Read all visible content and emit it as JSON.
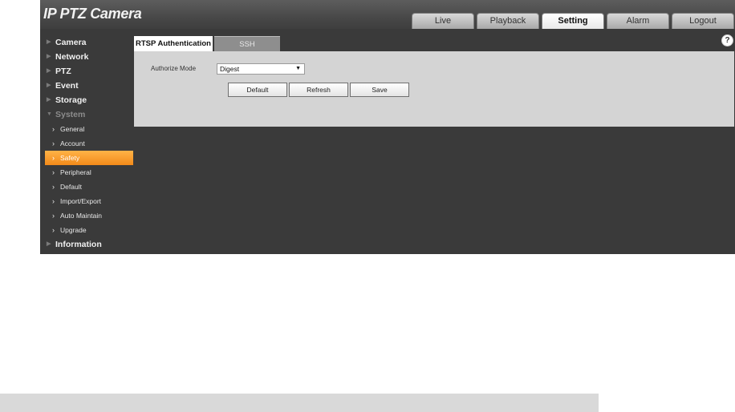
{
  "app": {
    "title": "IP PTZ Camera"
  },
  "nav": {
    "tabs": [
      {
        "label": "Live"
      },
      {
        "label": "Playback"
      },
      {
        "label": "Setting",
        "active": true
      },
      {
        "label": "Alarm"
      },
      {
        "label": "Logout"
      }
    ]
  },
  "sidebar": {
    "items": [
      {
        "label": "Camera"
      },
      {
        "label": "Network"
      },
      {
        "label": "PTZ"
      },
      {
        "label": "Event"
      },
      {
        "label": "Storage"
      },
      {
        "label": "System",
        "expanded": true
      }
    ],
    "system_sub": [
      {
        "label": "General"
      },
      {
        "label": "Account"
      },
      {
        "label": "Safety",
        "active": true
      },
      {
        "label": "Peripheral"
      },
      {
        "label": "Default"
      },
      {
        "label": "Import/Export"
      },
      {
        "label": "Auto Maintain"
      },
      {
        "label": "Upgrade"
      }
    ],
    "last": {
      "label": "Information"
    }
  },
  "content": {
    "tabs": [
      {
        "label": "RTSP Authentication",
        "active": true
      },
      {
        "label": "SSH"
      }
    ],
    "authorize_mode_label": "Authorize Mode",
    "authorize_mode_value": "Digest",
    "buttons": {
      "default": "Default",
      "refresh": "Refresh",
      "save": "Save"
    }
  },
  "icons": {
    "help": "help-icon",
    "arrow": "dropdown-arrow-icon",
    "chevron": "chevron-right-icon",
    "triangle": "triangle-right-icon"
  },
  "colors": {
    "accent": "#f28a1a",
    "background": "#3a3a3a",
    "panel": "#d4d4d4"
  }
}
